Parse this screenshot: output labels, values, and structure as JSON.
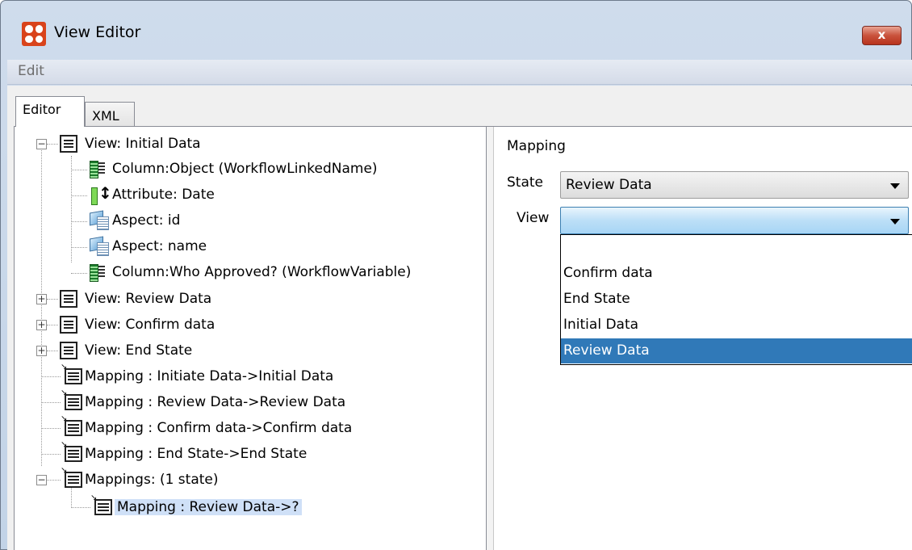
{
  "window": {
    "title": "View Editor",
    "close_label": "x"
  },
  "menu": {
    "edit": "Edit"
  },
  "tabs": {
    "editor": "Editor",
    "xml": "XML"
  },
  "tree": {
    "view_initial": "View: Initial Data",
    "col_object": "Column:Object (WorkflowLinkedName)",
    "attr_date": "Attribute: Date",
    "aspect_id": "Aspect: id",
    "aspect_name": "Aspect: name",
    "col_who": "Column:Who Approved? (WorkflowVariable)",
    "view_review": "View: Review Data",
    "view_confirm": "View: Confirm data",
    "view_end": "View: End State",
    "map_initiate": "Mapping : Initiate Data->Initial Data",
    "map_review": "Mapping : Review Data->Review Data",
    "map_confirm": "Mapping : Confirm data->Confirm data",
    "map_end": "Mapping : End State->End State",
    "mappings": "Mappings: (1 state)",
    "map_selected": "Mapping : Review Data->?",
    "expand_minus": "−",
    "expand_plus": "+"
  },
  "panel": {
    "title": "Mapping",
    "state_label": "State",
    "state_value": "Review Data",
    "view_label": "View",
    "view_value": "",
    "view_options": [
      "",
      "Confirm data",
      "End State",
      "Initial Data",
      "Review Data"
    ],
    "selected_option": "Review Data"
  }
}
